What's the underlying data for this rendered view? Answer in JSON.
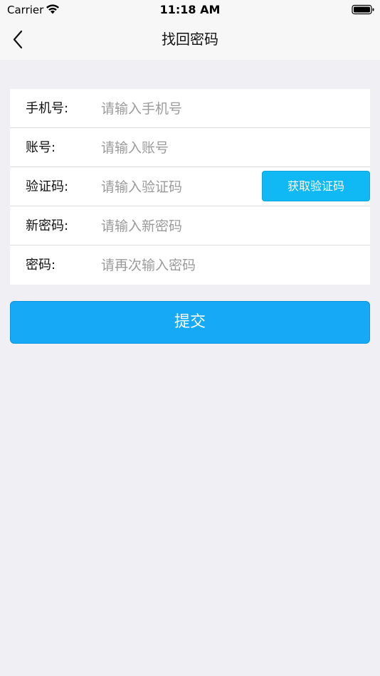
{
  "status_bar": {
    "carrier": "Carrier",
    "time": "11:18 AM"
  },
  "nav": {
    "title": "找回密码",
    "back_icon": "chevron-left-icon"
  },
  "form": {
    "rows": [
      {
        "label": "手机号:",
        "placeholder": "请输入手机号",
        "value": ""
      },
      {
        "label": "账号:",
        "placeholder": "请输入账号",
        "value": ""
      },
      {
        "label": "验证码:",
        "placeholder": "请输入验证码",
        "value": ""
      },
      {
        "label": "新密码:",
        "placeholder": "请输入新密码",
        "value": ""
      },
      {
        "label": "密码:",
        "placeholder": "请再次输入密码",
        "value": ""
      }
    ],
    "get_code_label": "获取验证码"
  },
  "submit_label": "提交",
  "colors": {
    "background": "#efeff4",
    "accent": "#16aaf6",
    "code_button": "#10b8f4"
  }
}
